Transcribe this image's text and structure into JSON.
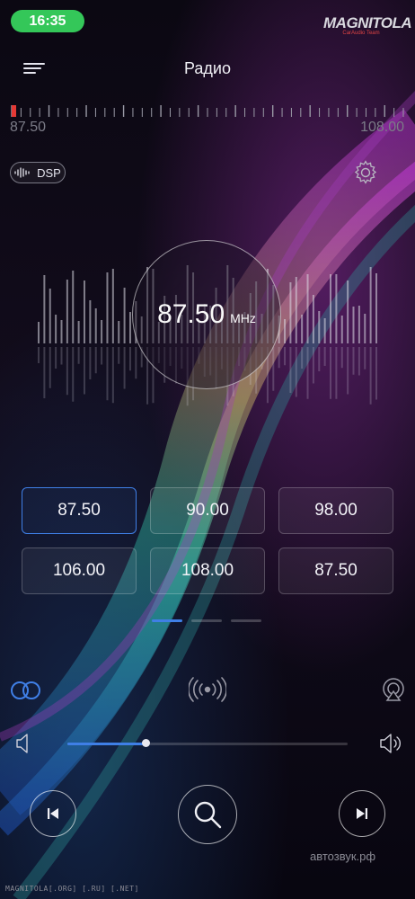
{
  "status": {
    "time": "16:35"
  },
  "logo": {
    "name": "MAGNITOLA",
    "tagline": "CarAudio Team"
  },
  "header": {
    "title": "Радио"
  },
  "scale": {
    "min_label": "87.50",
    "max_label": "108.00",
    "position": 0.0
  },
  "dsp": {
    "label": "DSP"
  },
  "display": {
    "frequency": "87.50",
    "unit": "MHz"
  },
  "presets": [
    "87.50",
    "90.00",
    "98.00",
    "106.00",
    "108.00",
    "87.50"
  ],
  "preset_active_index": 0,
  "pages": {
    "count": 3,
    "current": 0
  },
  "volume": {
    "level": 0.28
  },
  "watermark": {
    "text": "автозвук.рф"
  },
  "footer": {
    "text": "MAGNITOLA[.ORG] [.RU] [.NET]"
  },
  "colors": {
    "accent": "#3f7fe6",
    "status_pill": "#34c759",
    "marker": "#e53935"
  },
  "icons": {
    "menu": "menu-icon",
    "settings": "gear-icon",
    "stereo": "stereo-circles-icon",
    "radio": "radio-waves-icon",
    "airplay": "airplay-icon",
    "vol_low": "speaker-low-icon",
    "vol_high": "speaker-high-icon",
    "prev": "skip-previous-icon",
    "search": "search-icon",
    "next": "skip-next-icon"
  }
}
